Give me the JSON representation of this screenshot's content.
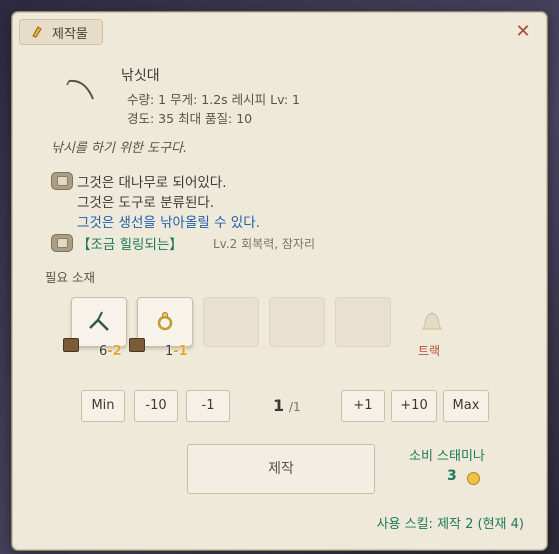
{
  "window": {
    "title": "제작물",
    "colors": {
      "panel": "#efe9d9",
      "close": "#a84a3c",
      "accent_green": "#1d7a5a",
      "accent_blue": "#1f5fae",
      "count_minus": "#e0a92c"
    }
  },
  "item": {
    "name": "낚싯대",
    "stats_line1": "수량: 1  무게: 1.2s   레시피 Lv: 1",
    "stats_line2": "경도: 35   최대 품질: 10",
    "description": "낚시를 하기 위한 도구다.",
    "icon": "fishing-rod-icon"
  },
  "properties": {
    "line1": "그것은 대나무로 되어있다.",
    "line2": "그것은 도구로 분류된다.",
    "line3": "그것은 생선을 낚아올릴 수 있다.",
    "trait_name": "【조금 힐링되는】",
    "trait_detail": "Lv.2 회복력, 잠자리"
  },
  "materials": {
    "label": "필요 소재",
    "slots": [
      {
        "icon": "fishing-rod-part-icon",
        "owned": "6",
        "cost": "-2"
      },
      {
        "icon": "ring-icon",
        "owned": "1",
        "cost": "-1"
      }
    ],
    "extra_slot_label": "트랙"
  },
  "quantity": {
    "min_label": "Min",
    "minus10_label": "-10",
    "minus1_label": "-1",
    "value": "1",
    "total": "/1",
    "plus1_label": "+1",
    "plus10_label": "+10",
    "max_label": "Max"
  },
  "craft": {
    "button_label": "제작",
    "stamina_label": "소비 스태미나",
    "stamina_value": "3"
  },
  "skill": {
    "text": "사용 스킬: 제작 2 (현재 4)"
  }
}
